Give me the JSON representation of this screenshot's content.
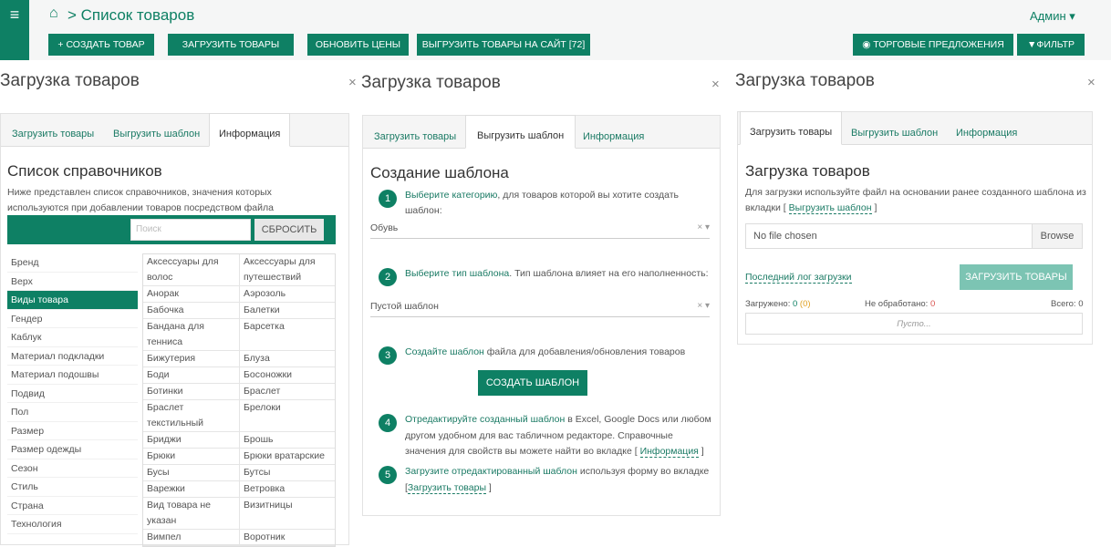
{
  "header": {
    "menu_icon": "hamburger-icon",
    "home_icon": "home-icon",
    "breadcrumb": "> Список товаров",
    "user": "Админ ▾",
    "buttons": [
      "+ СОЗДАТЬ ТОВАР",
      "ЗАГРУЗИТЬ ТОВАРЫ",
      "ОБНОВИТЬ ЦЕНЫ",
      "ВЫГРУЗИТЬ ТОВАРЫ НА САЙТ [72]"
    ],
    "right_buttons": [
      "ТОРГОВЫЕ ПРЕДЛОЖЕНИЯ",
      "ФИЛЬТР"
    ]
  },
  "panel_title": "Загрузка товаров",
  "close": "×",
  "tabs": [
    "Загрузить товары",
    "Выгрузить шаблон",
    "Информация"
  ],
  "info": {
    "title": "Список справочников",
    "desc": "Ниже представлен список справочников, значения которых используются при добавлении товаров посредством файла",
    "search_placeholder": "Поиск",
    "reset": "СБРОСИТЬ",
    "categories": [
      "Бренд",
      "Верх",
      "Виды товара",
      "Гендер",
      "Каблук",
      "Материал подкладки",
      "Материал подошвы",
      "Подвид",
      "Пол",
      "Размер",
      "Размер одежды",
      "Сезон",
      "Стиль",
      "Страна",
      "Технология"
    ],
    "values": [
      [
        "Аксессуары для волос",
        "Аксессуары для путешествий"
      ],
      [
        "Анорак",
        "Аэрозоль"
      ],
      [
        "Бабочка",
        "Балетки"
      ],
      [
        "Бандана для тенниса",
        "Барсетка"
      ],
      [
        "Бижутерия",
        "Блуза"
      ],
      [
        "Боди",
        "Босоножки"
      ],
      [
        "Ботинки",
        "Браслет"
      ],
      [
        "Браслет текстильный",
        "Брелоки"
      ],
      [
        "Бриджи",
        "Брошь"
      ],
      [
        "Брюки",
        "Брюки вратарские"
      ],
      [
        "Бусы",
        "Бутсы"
      ],
      [
        "Варежки",
        "Ветровка"
      ],
      [
        "Вид товара не указан",
        "Визитницы"
      ],
      [
        "Вимпел",
        "Воротник"
      ]
    ]
  },
  "template": {
    "title": "Создание шаблона",
    "s1_link": "Выберите категорию",
    "s1_text": ", для товаров которой вы хотите создать шаблон:",
    "s1_value": "Обувь",
    "s2_link": "Выберите тип шаблона",
    "s2_text": ". Тип шаблона влияет на его наполненность:",
    "s2_value": "Пустой шаблон",
    "s3_link": "Создайте шаблон",
    "s3_text": " файла для добавления/обновления товаров",
    "create_btn": "СОЗДАТЬ ШАБЛОН",
    "s4_link": "Отредактируйте созданный шаблон",
    "s4_text": " в Excel, Google Docs или любом другом удобном для вас табличном редакторе. Справочные значения для свойств вы можете найти во вкладке [",
    "s4_tab": "Информация",
    "s4_end": "]",
    "s5_link": "Загрузите отредактированный шаблон",
    "s5_text": " используя форму во вкладке [",
    "s5_tab": "Загрузить товары",
    "s5_end": "]",
    "clear": "× ▾"
  },
  "upload": {
    "title": "Загрузка товаров",
    "desc": "Для загрузки используйте файл на основании ранее созданного шаблона из вкладки [",
    "desc_link": "Выгрузить шаблон",
    "desc_end": "]",
    "file": "No file chosen",
    "browse": "Browse",
    "log": "Последний лог загрузки",
    "upload_btn": "ЗАГРУЗИТЬ ТОВАРЫ",
    "loaded_label": "Загружено:",
    "loaded": "0",
    "loaded_extra": "(0)",
    "unprocessed_label": "Не обработано:",
    "unprocessed": "0",
    "total_label": "Всего:",
    "total": "0",
    "empty": "Пусто..."
  }
}
